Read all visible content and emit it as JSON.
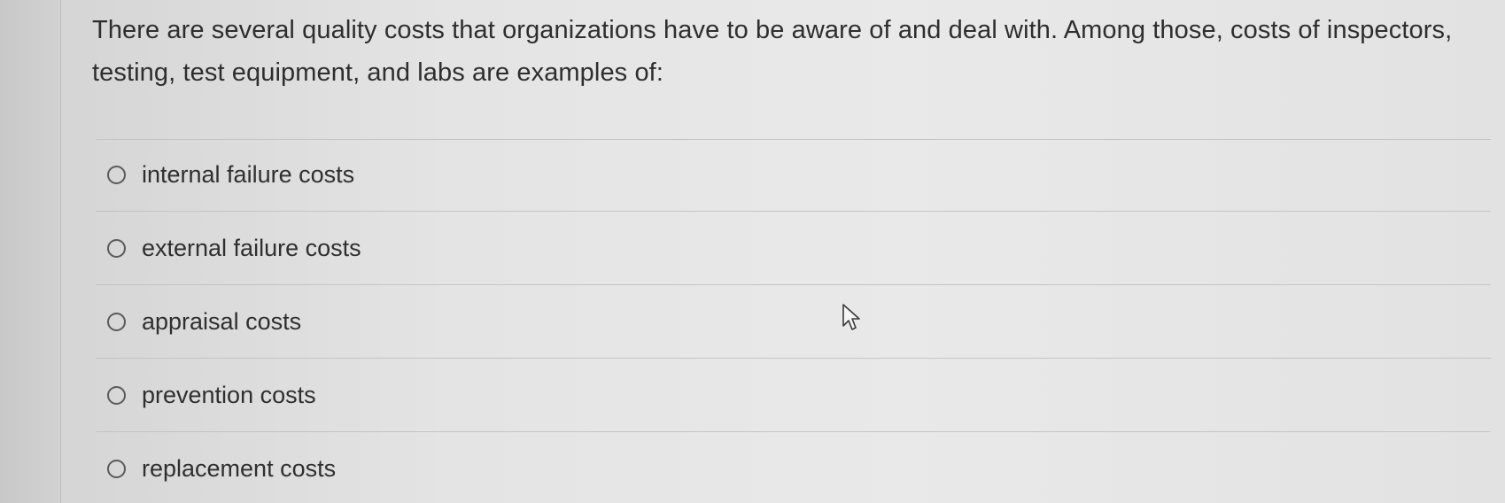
{
  "question": {
    "text": "There are several quality costs that organizations have to be aware of and deal with. Among those, costs of inspectors, testing, test equipment, and labs are examples of:"
  },
  "options": [
    {
      "label": "internal failure costs",
      "selected": false
    },
    {
      "label": "external failure costs",
      "selected": false
    },
    {
      "label": "appraisal costs",
      "selected": false
    },
    {
      "label": "prevention costs",
      "selected": false
    },
    {
      "label": "replacement costs",
      "selected": false
    }
  ],
  "colors": {
    "text": "#2e2e2e",
    "divider": "#c4c4c4",
    "radio_border": "#5a5a5a"
  },
  "icons": {
    "cursor": "arrow-cursor-icon",
    "radio": "radio-unchecked-icon"
  }
}
